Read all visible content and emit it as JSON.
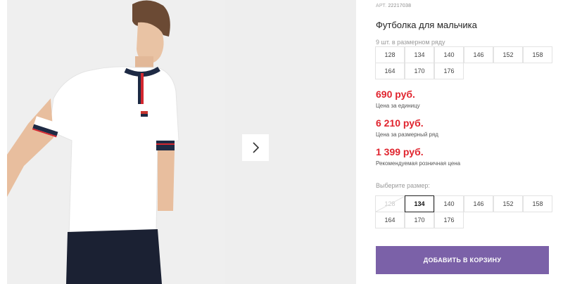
{
  "product": {
    "article_label": "АРТ.",
    "article_number": "22217038",
    "title": "Футболка для мальчика"
  },
  "size_row": {
    "note": "9 шт. в размерном ряду",
    "sizes": [
      "128",
      "134",
      "140",
      "146",
      "152",
      "158",
      "164",
      "170",
      "176"
    ]
  },
  "prices": [
    {
      "value": "690 руб.",
      "label": "Цена за единицу"
    },
    {
      "value": "6 210 руб.",
      "label": "Цена за размерный ряд"
    },
    {
      "value": "1 399 руб.",
      "label": "Рекомендуемая розничная цена"
    }
  ],
  "size_select": {
    "label": "Выберите размер:",
    "options": [
      "128",
      "134",
      "140",
      "146",
      "152",
      "158",
      "164",
      "170",
      "176"
    ],
    "selected": "134",
    "unavailable": [
      "128"
    ]
  },
  "cart_button_label": "ДОБАВИТЬ В КОРЗИНУ",
  "gallery": {
    "next_icon": "chevron-right-icon"
  },
  "colors": {
    "price": "#e0242e",
    "button": "#7b61a8"
  }
}
